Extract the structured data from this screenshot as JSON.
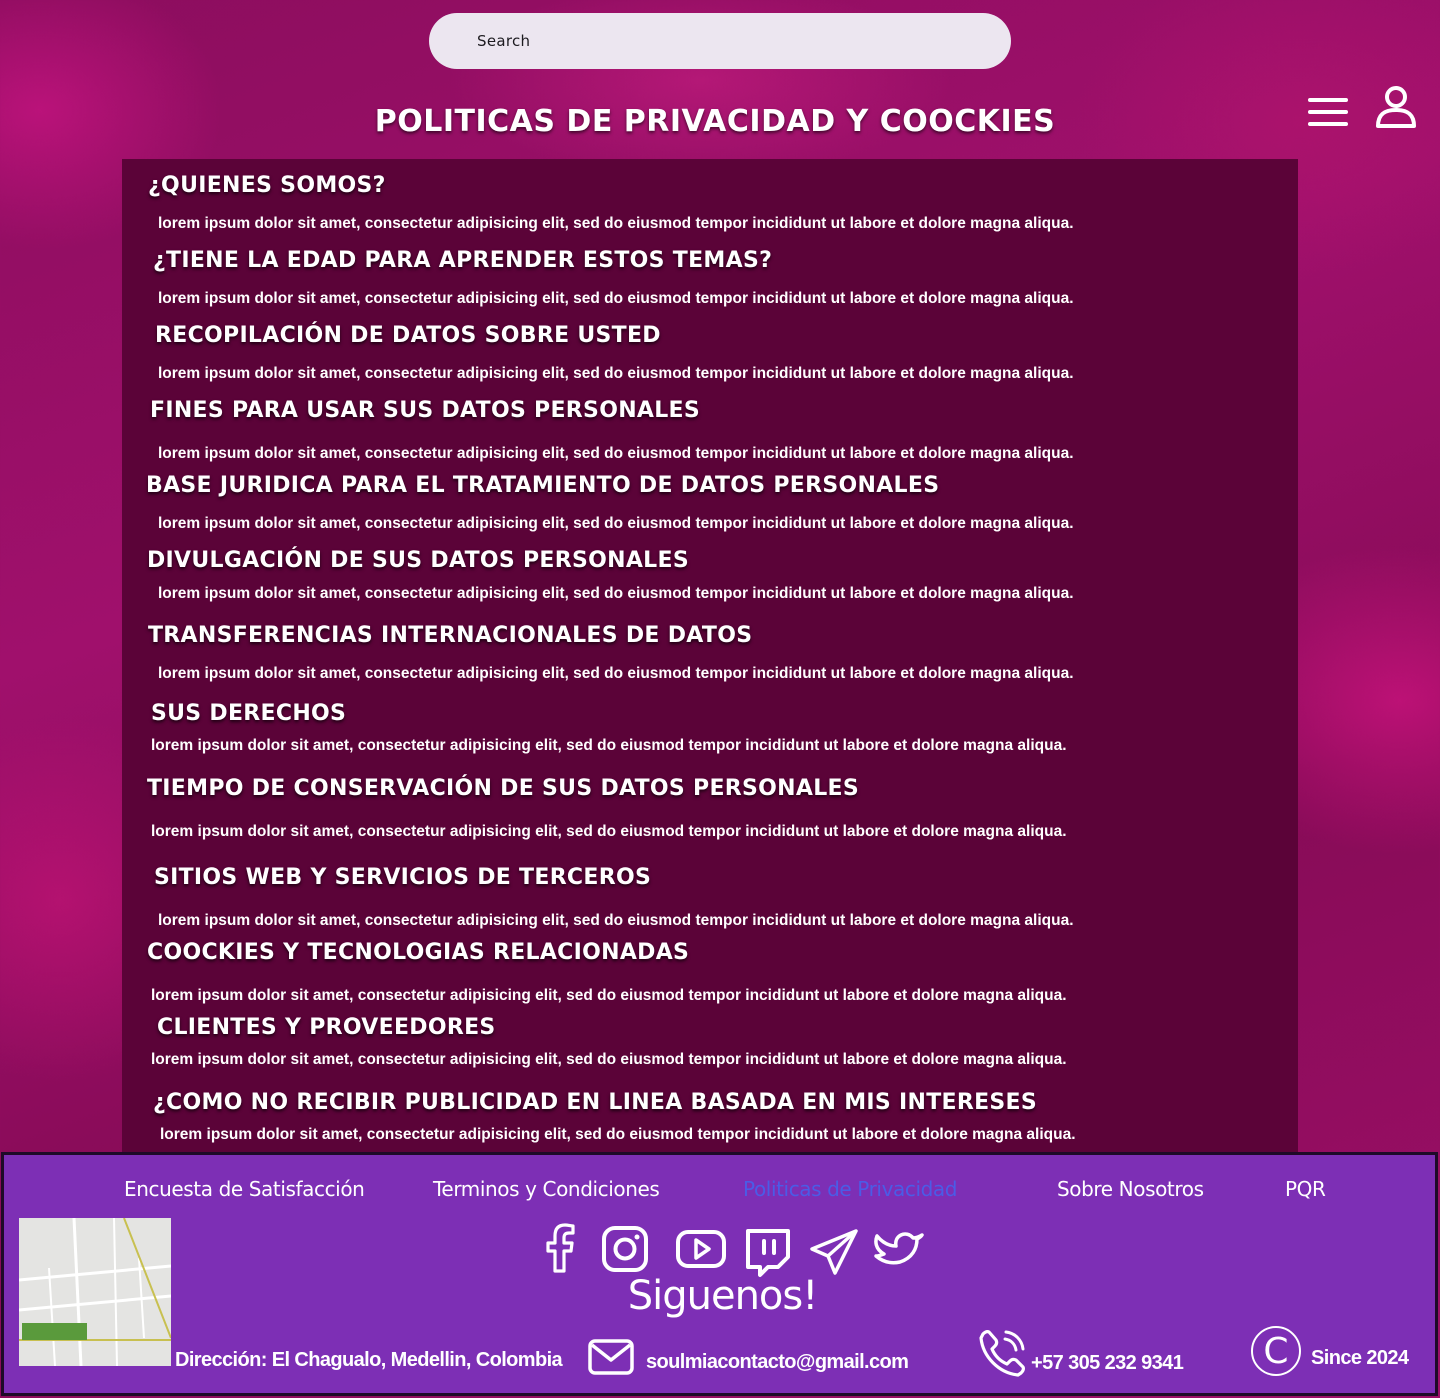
{
  "search": {
    "placeholder": "Search"
  },
  "page_title": "POLITICAS DE PRIVACIDAD Y COOCKIES",
  "sections": [
    {
      "heading": "¿QUIENES SOMOS?",
      "body": "lorem ipsum dolor sit amet, consectetur adipisicing elit, sed do eiusmod tempor incididunt ut labore et dolore magna aliqua."
    },
    {
      "heading": "¿TIENE LA EDAD PARA APRENDER ESTOS TEMAS?",
      "body": "lorem ipsum dolor sit amet, consectetur adipisicing elit, sed do eiusmod tempor incididunt ut labore et dolore magna aliqua."
    },
    {
      "heading": "RECOPILACIÓN DE DATOS SOBRE USTED",
      "body": "lorem ipsum dolor sit amet, consectetur adipisicing elit, sed do eiusmod tempor incididunt ut labore et dolore magna aliqua."
    },
    {
      "heading": "FINES PARA USAR SUS DATOS PERSONALES",
      "body": "lorem ipsum dolor sit amet, consectetur adipisicing elit, sed do eiusmod tempor incididunt ut labore et dolore magna aliqua."
    },
    {
      "heading": "BASE JURIDICA PARA EL TRATAMIENTO DE DATOS PERSONALES",
      "body": "lorem ipsum dolor sit amet, consectetur adipisicing elit, sed do eiusmod tempor incididunt ut labore et dolore magna aliqua."
    },
    {
      "heading": "DIVULGACIÓN DE SUS DATOS PERSONALES",
      "body": "lorem ipsum dolor sit amet, consectetur adipisicing elit, sed do eiusmod tempor incididunt ut labore et dolore magna aliqua."
    },
    {
      "heading": "TRANSFERENCIAS INTERNACIONALES DE DATOS",
      "body": "lorem ipsum dolor sit amet, consectetur adipisicing elit, sed do eiusmod tempor incididunt ut labore et dolore magna aliqua."
    },
    {
      "heading": "SUS DERECHOS",
      "body": "lorem ipsum dolor sit amet, consectetur adipisicing elit, sed do eiusmod tempor incididunt ut labore et dolore magna aliqua."
    },
    {
      "heading": "TIEMPO DE CONSERVACIÓN DE SUS DATOS PERSONALES",
      "body": "lorem ipsum dolor sit amet, consectetur adipisicing elit, sed do eiusmod tempor incididunt ut labore et dolore magna aliqua."
    },
    {
      "heading": "SITIOS WEB Y SERVICIOS DE TERCEROS",
      "body": "lorem ipsum dolor sit amet, consectetur adipisicing elit, sed do eiusmod tempor incididunt ut labore et dolore magna aliqua."
    },
    {
      "heading": "COOCKIES Y TECNOLOGIAS RELACIONADAS",
      "body": "lorem ipsum dolor sit amet, consectetur adipisicing elit, sed do eiusmod tempor incididunt ut labore et dolore magna aliqua."
    },
    {
      "heading": "CLIENTES Y PROVEEDORES",
      "body": "lorem ipsum dolor sit amet, consectetur adipisicing elit, sed do eiusmod tempor incididunt ut labore et dolore magna aliqua."
    },
    {
      "heading": "¿COMO NO RECIBIR PUBLICIDAD EN LINEA BASADA EN MIS INTERESES",
      "body": "lorem ipsum dolor sit amet, consectetur adipisicing elit, sed do eiusmod tempor incididunt ut labore et dolore magna aliqua."
    }
  ],
  "footer": {
    "links": [
      "Encuesta de Satisfacción",
      "Terminos y Condiciones",
      "Politicas de Privacidad",
      "Sobre Nosotros",
      "PQR"
    ],
    "active_link": "Politicas de Privacidad",
    "social_icons": [
      "facebook-icon",
      "instagram-icon",
      "youtube-icon",
      "twitch-icon",
      "telegram-icon",
      "twitter-icon"
    ],
    "follow_label": "Siguenos!",
    "address": "Dirección: El Chagualo, Medellin, Colombia",
    "email": "soulmiacontacto@gmail.com",
    "phone": "+57 305 232 9341",
    "copyright_symbol": "C",
    "since": "Since 2024"
  },
  "colors": {
    "panel": "#5b0338",
    "footer": "#7d2fb5",
    "active_link": "#4b5ce6",
    "search_bg": "#ece6f0"
  }
}
